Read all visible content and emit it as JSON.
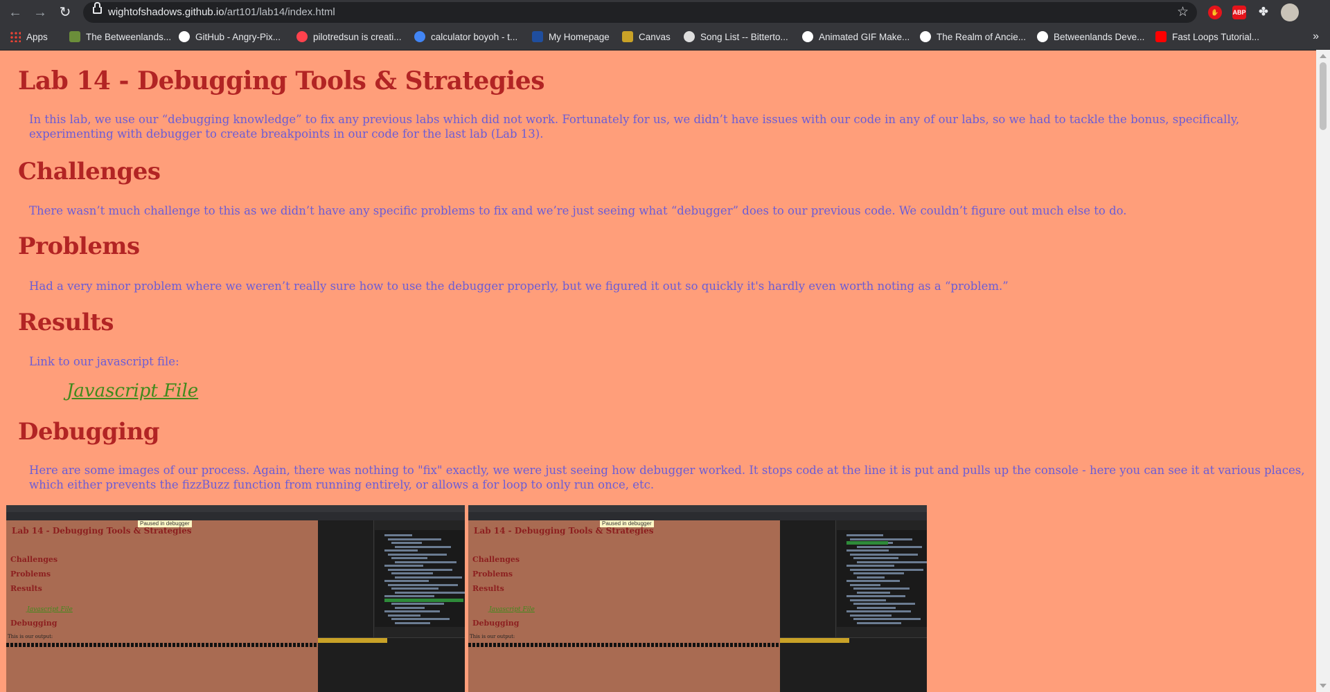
{
  "browser": {
    "url_host": "wightofshadows.github.io",
    "url_path": "/art101/lab14/index.html",
    "extensions": [
      "ABP"
    ],
    "bookmarks": [
      {
        "label": "Apps",
        "icon": "apps-grid-icon",
        "color": "#ea4335"
      },
      {
        "label": "The Betweenlands...",
        "icon": "betweenlands-icon",
        "color": "#6b8e3a"
      },
      {
        "label": "GitHub - Angry-Pix...",
        "icon": "github-icon",
        "color": "#ffffff"
      },
      {
        "label": "pilotredsun is creati...",
        "icon": "patreon-icon",
        "color": "#ff424d"
      },
      {
        "label": "calculator boyoh - t...",
        "icon": "google-icon",
        "color": "#4285f4"
      },
      {
        "label": "My Homepage",
        "icon": "ucsc-icon",
        "color": "#1f4e9e"
      },
      {
        "label": "Canvas",
        "icon": "canvas-icon",
        "color": "#c9a227"
      },
      {
        "label": "Song List -- Bitterto...",
        "icon": "song-icon",
        "color": "#dddddd"
      },
      {
        "label": "Animated GIF Make...",
        "icon": "gif-icon",
        "color": "#ffffff"
      },
      {
        "label": "The Realm of Ancie...",
        "icon": "realm-icon",
        "color": "#ffffff"
      },
      {
        "label": "Betweenlands Deve...",
        "icon": "github-icon",
        "color": "#ffffff"
      },
      {
        "label": "Fast Loops Tutorial...",
        "icon": "youtube-icon",
        "color": "#ff0000"
      }
    ],
    "more_label": "»"
  },
  "page": {
    "title": "Lab 14 - Debugging Tools & Strategies",
    "intro": "In this lab, we use our “debugging knowledge” to fix any previous labs which did not work. Fortunately for us, we didn’t have issues with our code in any of our labs, so we had to tackle the bonus, specifically, experimenting with debugger to create breakpoints in our code for the last lab (Lab 13).",
    "sections": {
      "challenges": {
        "heading": "Challenges",
        "text": "There wasn’t much challenge to this as we didn’t have any specific problems to fix and we’re just seeing what “debugger” does to our previous code. We couldn’t figure out much else to do."
      },
      "problems": {
        "heading": "Problems",
        "text": "Had a very minor problem where we weren’t really sure how to use the debugger properly, but we figured it out so quickly it's hardly even worth noting as a “problem.”"
      },
      "results": {
        "heading": "Results",
        "text": "Link to our javascript file:",
        "link": "Javascript File"
      },
      "debugging": {
        "heading": "Debugging",
        "text": "Here are some images of our process. Again, there was nothing to \"fix\" exactly, we were just seeing how debugger worked. It stops code at the line it is put and pulls up the console - here you can see it at various places, which either prevents the fizzBuzz function from running entirely, or allows a for loop to only run once, etc."
      }
    },
    "screenshots": [
      {
        "mini_title": "Lab 14 - Debugging Tools & Strategies",
        "mini_headings": [
          "Challenges",
          "Problems",
          "Results",
          "Debugging"
        ],
        "mini_link": "Javascript File",
        "mini_output": "This is our output:",
        "paused": "Paused in debugger"
      },
      {
        "mini_title": "Lab 14 - Debugging Tools & Strategies",
        "mini_headings": [
          "Challenges",
          "Problems",
          "Results",
          "Debugging"
        ],
        "mini_link": "Javascript File",
        "mini_output": "This is our output:",
        "paused": "Paused in debugger"
      }
    ]
  },
  "colors": {
    "page_bg": "#ff9e7a",
    "heading": "#b22424",
    "body_text": "#6b5cd6",
    "link": "#3f8a1c"
  }
}
